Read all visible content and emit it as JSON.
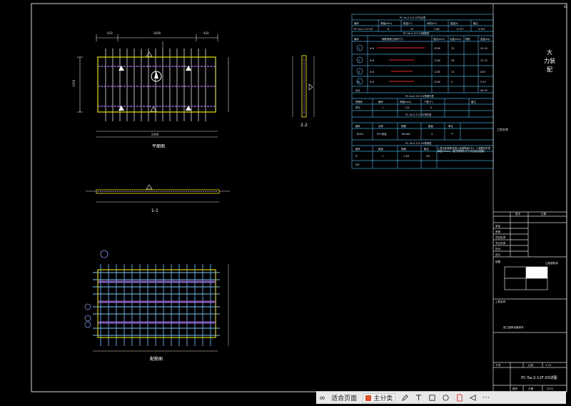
{
  "drawing": {
    "plan_label": "平面图",
    "section_11_label": "1-1",
    "section_22_label": "2-2",
    "rebar_label": "配筋图",
    "page_number": "42",
    "dim_top": [
      "420",
      "1600",
      "420"
    ],
    "dim_bottom": [
      "2440"
    ],
    "dim_left": [
      "1200"
    ]
  },
  "table": {
    "title1": "PC-5a-2-11F-03节点表",
    "head1": [
      "编号",
      "规格(mm)",
      "数量(个)",
      "体积(m³)",
      "重量(t)",
      "备注"
    ],
    "row1": [
      "PC-5a-2-11F-03",
      "8",
      "25",
      "1.68",
      "0.127",
      "0.342"
    ],
    "title2": "PC-5a-2-11F-03钢筋表",
    "head2": [
      "编号",
      "钢筋简图(注明尺寸)",
      "直径(mm)",
      "长度(mm)",
      "根数",
      "重量(kg)"
    ],
    "rows2": [
      [
        "1",
        "Φ 8",
        "2238",
        "25",
        "22.16"
      ],
      [
        "2",
        "Φ 8",
        "1238",
        "26",
        "12.73"
      ],
      [
        "3",
        "Φ 8",
        "1238",
        "14",
        "6.87"
      ],
      [
        "4a",
        "Φ 8",
        "2238",
        "4",
        "3.53"
      ],
      [
        "合计",
        "",
        "",
        "",
        "45.29"
      ]
    ],
    "title3": "PC-5a-2-11F-03预埋件表",
    "head3": [
      "预埋件",
      "编号",
      "规格(mm)",
      "个数(个)",
      "备注"
    ],
    "row3": [
      "吊钉",
      "1",
      "1.5t",
      "4",
      ""
    ],
    "title4": "PC-5a-2-11F-03材料表",
    "head4": [
      "编号",
      "名称",
      "规格",
      "数量",
      "单位"
    ],
    "row4": [
      "B024",
      "PVC线盒",
      "86×86",
      "3",
      "个"
    ],
    "title5": "PC-5a-2-11F-03预埋表",
    "head5": [
      "编号",
      "数量",
      "规格",
      "备注"
    ],
    "rows5": [
      [
        "JT",
        "1",
        "1.3M",
        "CM"
      ],
      [
        "JXR",
        "",
        "",
        ""
      ]
    ],
    "note": "1.叠合板钢筋混凝土强度等级C30。2.钢筋保护层厚度15mm，图中预埋件尺寸详见相关图集。"
  },
  "titleblock": {
    "company": "大\n力装\n配",
    "stamp_label": "注册建筑师",
    "small_label": "施工图审查备案号",
    "row_labels": [
      "审定",
      "审核",
      "项目负责",
      "专业负责",
      "校对",
      "设计",
      "制图"
    ],
    "col_labels": [
      "签字",
      "日期"
    ],
    "project": "工程名称",
    "scale_label": "比例",
    "scale": "1:25",
    "drawing_no_label": "图号",
    "date_label": "日期",
    "date": "2022",
    "title": "PC-5a-2-11F-03详图",
    "sub_label": "子项"
  },
  "toolbar": {
    "items": [
      "适合页面",
      "主分类"
    ],
    "accent": "#e0502c"
  }
}
